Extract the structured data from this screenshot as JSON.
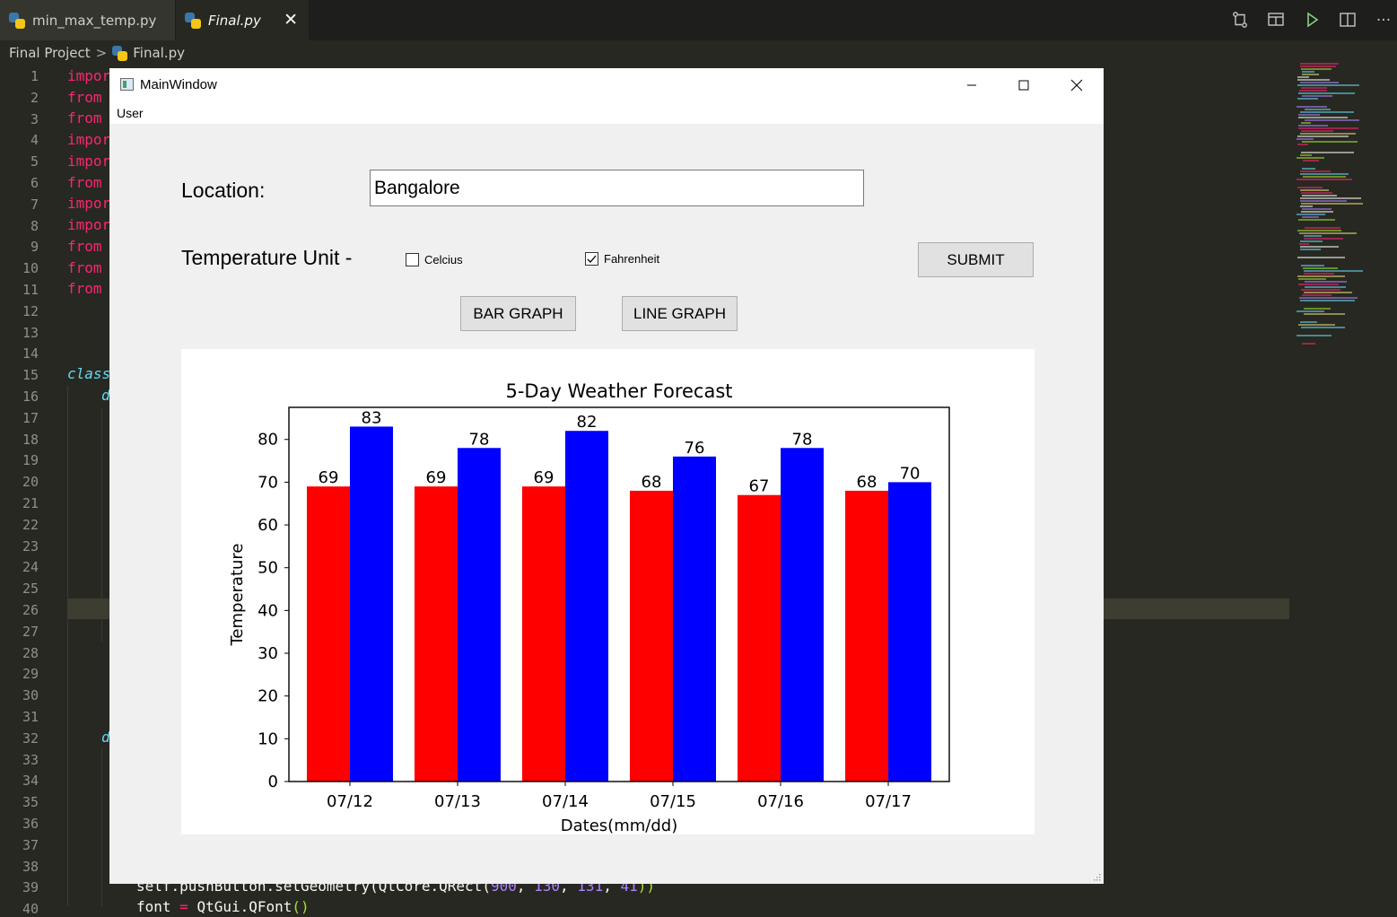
{
  "editor": {
    "tabs": [
      {
        "label": "min_max_temp.py",
        "active": false
      },
      {
        "label": "Final.py",
        "active": true
      }
    ],
    "breadcrumb": {
      "folder": "Final Project",
      "file": "Final.py"
    },
    "line_numbers": [
      "1",
      "2",
      "3",
      "4",
      "5",
      "6",
      "7",
      "8",
      "9",
      "10",
      "11",
      "12",
      "13",
      "14",
      "15",
      "16",
      "17",
      "18",
      "19",
      "20",
      "21",
      "22",
      "23",
      "24",
      "25",
      "26",
      "27",
      "28",
      "29",
      "30",
      "31",
      "32",
      "33",
      "34",
      "35",
      "36",
      "37",
      "38",
      "39",
      "40"
    ],
    "code_fragments": {
      "l1": "impor",
      "l2": "from",
      "l3": "from",
      "l4": "impor",
      "l5": "impor",
      "l6": "from",
      "l7": "impor",
      "l8": "impor",
      "l9": "from",
      "l10": "from",
      "l11": "from",
      "l15": "class",
      "l16": "d",
      "l32": "d"
    },
    "bottom_code": {
      "line39_prefix": "self.pushButton.setGeometry(QtCore.QRect(",
      "line39_n1": "900",
      "line39_n2": "130",
      "line39_n3": "131",
      "line39_n4": "41",
      "line39_suffix": "))",
      "line40_var": "font",
      "line40_eq": " = ",
      "line40_call": "QtGui.QFont",
      "line40_paren": "()"
    },
    "colors": {
      "background": "#272822",
      "keyword": "#f92672",
      "class_keyword": "#66d9ef",
      "number": "#ae81ff"
    }
  },
  "window": {
    "title": "MainWindow",
    "menu": [
      "User"
    ],
    "location_label": "Location:",
    "location_value": "Bangalore",
    "unit_label": "Temperature Unit -",
    "celsius_label": "Celcius",
    "celsius_checked": false,
    "fahrenheit_label": "Fahrenheit",
    "fahrenheit_checked": true,
    "submit_label": "SUBMIT",
    "bar_graph_label": "BAR GRAPH",
    "line_graph_label": "LINE GRAPH"
  },
  "chart_data": {
    "type": "bar",
    "title": "5-Day Weather Forecast",
    "xlabel": "Dates(mm/dd)",
    "ylabel": "Temperature",
    "categories": [
      "07/12",
      "07/13",
      "07/14",
      "07/15",
      "07/16",
      "07/17"
    ],
    "series": [
      {
        "color": "#ff0000",
        "values": [
          69,
          69,
          69,
          68,
          67,
          68
        ]
      },
      {
        "color": "#0000ff",
        "values": [
          83,
          78,
          82,
          76,
          78,
          70
        ]
      }
    ],
    "yticks": [
      0,
      10,
      20,
      30,
      40,
      50,
      60,
      70,
      80
    ],
    "ylim": [
      0,
      87.5
    ],
    "grid": false
  }
}
